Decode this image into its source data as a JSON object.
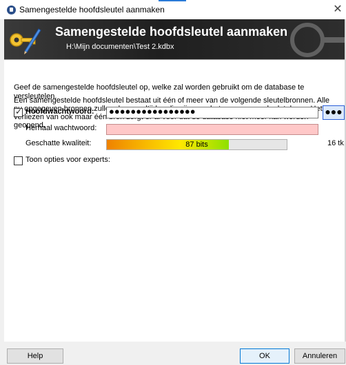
{
  "window": {
    "title": "Samengestelde hoofdsleutel aanmaken",
    "close_glyph": "✕"
  },
  "banner": {
    "heading": "Samengestelde hoofdsleutel aanmaken",
    "path": "H:\\Mijn documenten\\Test 2.kdbx",
    "icon": "key-icon"
  },
  "intro": {
    "line1": "Geef de samengestelde hoofdsleutel op, welke zal worden gebruikt om de database te versleutelen.",
    "line2": "Een samengestelde hoofdsleutel bestaat uit één of meer van de volgende sleutelbronnen. Alle nu opgegeven bronnen zullen daarna altijd nodig zijn voor het openen van de database. Het verliezen van ook maar één bron zorgt er al voor dat de database niet meer kan worden geopend."
  },
  "master_password": {
    "checked": true,
    "label": "Hoofdwachtwoord:",
    "value": "●●●●●●●●●●●●●●●●",
    "reveal_label": "●●●"
  },
  "repeat_password": {
    "label": "Herhaal wachtwoord:",
    "value": ""
  },
  "quality": {
    "label": "Geschatte kwaliteit:",
    "bits_text": "87 bits",
    "fraction": 0.68,
    "chars_text": "16 tk."
  },
  "expert_options": {
    "checked": false,
    "label": "Toon opties voor experts:"
  },
  "buttons": {
    "help": "Help",
    "ok": "OK",
    "cancel": "Annuleren"
  }
}
